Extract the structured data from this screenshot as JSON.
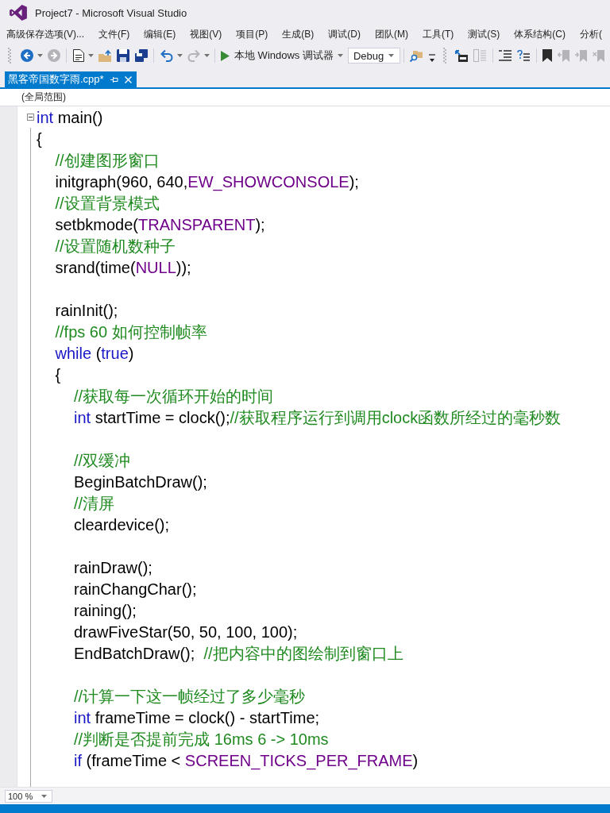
{
  "window": {
    "title": "Project7 - Microsoft Visual Studio"
  },
  "menu_bar": [
    "高级保存选项(V)...",
    "文件(F)",
    "编辑(E)",
    "视图(V)",
    "项目(P)",
    "生成(B)",
    "调试(D)",
    "团队(M)",
    "工具(T)",
    "测试(S)",
    "体系结构(C)",
    "分析("
  ],
  "toolbars": [
    {
      "groups": [
        [
          {
            "kind": "back",
            "disabled": false,
            "dropdown": true
          },
          {
            "kind": "forward",
            "disabled": true,
            "dropdown": false
          }
        ],
        [
          {
            "kind": "new_project",
            "disabled": false,
            "dropdown": true
          },
          {
            "kind": "open_file",
            "disabled": false,
            "dropdown": false
          },
          {
            "kind": "save",
            "disabled": false,
            "dropdown": false
          },
          {
            "kind": "save_all",
            "disabled": false,
            "dropdown": false
          }
        ],
        [
          {
            "kind": "undo",
            "disabled": false,
            "dropdown": true
          },
          {
            "kind": "redo",
            "disabled": true,
            "dropdown": true
          }
        ],
        [
          {
            "kind": "start_debugging",
            "label": "本地 Windows 调试器",
            "disabled": false,
            "dropdown": true
          },
          {
            "kind": "configuration",
            "value": "Debug",
            "disabled": false,
            "dropdown": true
          }
        ],
        [
          {
            "kind": "find_in_files",
            "disabled": false,
            "dropdown": false
          }
        ]
      ]
    },
    {
      "groups": [
        [
          {
            "kind": "box_arrow",
            "disabled": false,
            "dropdown": false
          },
          {
            "kind": "columns",
            "disabled": true,
            "dropdown": false
          }
        ],
        [
          {
            "kind": "lines",
            "disabled": false,
            "dropdown": false
          },
          {
            "kind": "question_lines",
            "disabled": false,
            "dropdown": false
          }
        ],
        [
          {
            "kind": "bookmark",
            "disabled": false,
            "dropdown": false
          },
          {
            "kind": "bookmark_previous",
            "disabled": true,
            "dropdown": false
          },
          {
            "kind": "bookmark_next",
            "disabled": true,
            "dropdown": false
          },
          {
            "kind": "bookmark_clear",
            "disabled": true,
            "dropdown": false
          }
        ]
      ]
    }
  ],
  "tabs": [
    {
      "label": "黑客帝国数字雨.cpp*",
      "selected": true
    }
  ],
  "navigation_bar": {
    "scope": "(全局范围)"
  },
  "editor": {
    "regions": [
      {
        "expanded": true,
        "lines": [
          {
            "kind": "code",
            "tokens": [
              {
                "kind": "keyword",
                "text": "int"
              },
              {
                "kind": "plain",
                "text": " main()"
              }
            ]
          },
          {
            "kind": "code",
            "tokens": [
              {
                "kind": "plain",
                "text": "{"
              }
            ],
            "children": [
              {
                "kind": "code",
                "tokens": [
                  {
                    "kind": "comment",
                    "text": "//创建图形窗口"
                  }
                ]
              },
              {
                "kind": "code",
                "tokens": [
                  {
                    "kind": "plain",
                    "text": "initgraph(960, 640,"
                  },
                  {
                    "kind": "macro",
                    "text": "EW_SHOWCONSOLE"
                  },
                  {
                    "kind": "plain",
                    "text": ");"
                  }
                ]
              },
              {
                "kind": "code",
                "tokens": [
                  {
                    "kind": "comment",
                    "text": "//设置背景模式"
                  }
                ]
              },
              {
                "kind": "code",
                "tokens": [
                  {
                    "kind": "plain",
                    "text": "setbkmode("
                  },
                  {
                    "kind": "macro",
                    "text": "TRANSPARENT"
                  },
                  {
                    "kind": "plain",
                    "text": ");"
                  }
                ]
              },
              {
                "kind": "code",
                "tokens": [
                  {
                    "kind": "comment",
                    "text": "//设置随机数种子"
                  }
                ]
              },
              {
                "kind": "code",
                "tokens": [
                  {
                    "kind": "plain",
                    "text": "srand(time("
                  },
                  {
                    "kind": "macro",
                    "text": "NULL"
                  },
                  {
                    "kind": "plain",
                    "text": "));"
                  }
                ]
              },
              {
                "kind": "blank"
              },
              {
                "kind": "code",
                "tokens": [
                  {
                    "kind": "plain",
                    "text": "rainInit();"
                  }
                ]
              },
              {
                "kind": "code",
                "tokens": [
                  {
                    "kind": "comment",
                    "text": "//fps 60 如何控制帧率"
                  }
                ]
              },
              {
                "kind": "code",
                "tokens": [
                  {
                    "kind": "keyword",
                    "text": "while"
                  },
                  {
                    "kind": "plain",
                    "text": " ("
                  },
                  {
                    "kind": "keyword",
                    "text": "true"
                  },
                  {
                    "kind": "plain",
                    "text": ")"
                  }
                ]
              },
              {
                "kind": "code",
                "tokens": [
                  {
                    "kind": "plain",
                    "text": "{"
                  }
                ],
                "children": [
                  {
                    "kind": "code",
                    "tokens": [
                      {
                        "kind": "comment",
                        "text": "//获取每一次循环开始的时间"
                      }
                    ]
                  },
                  {
                    "kind": "code",
                    "tokens": [
                      {
                        "kind": "keyword",
                        "text": "int"
                      },
                      {
                        "kind": "plain",
                        "text": " startTime = clock();"
                      },
                      {
                        "kind": "comment",
                        "text": "//获取程序运行到调用clock函数所经过的毫秒数"
                      }
                    ]
                  },
                  {
                    "kind": "blank"
                  },
                  {
                    "kind": "code",
                    "tokens": [
                      {
                        "kind": "comment",
                        "text": "//双缓冲"
                      }
                    ]
                  },
                  {
                    "kind": "code",
                    "tokens": [
                      {
                        "kind": "plain",
                        "text": "BeginBatchDraw();"
                      }
                    ]
                  },
                  {
                    "kind": "code",
                    "tokens": [
                      {
                        "kind": "comment",
                        "text": "//清屏"
                      }
                    ]
                  },
                  {
                    "kind": "code",
                    "tokens": [
                      {
                        "kind": "plain",
                        "text": "cleardevice();"
                      }
                    ]
                  },
                  {
                    "kind": "blank"
                  },
                  {
                    "kind": "code",
                    "tokens": [
                      {
                        "kind": "plain",
                        "text": "rainDraw();"
                      }
                    ]
                  },
                  {
                    "kind": "code",
                    "tokens": [
                      {
                        "kind": "plain",
                        "text": "rainChangChar();"
                      }
                    ]
                  },
                  {
                    "kind": "code",
                    "tokens": [
                      {
                        "kind": "plain",
                        "text": "raining();"
                      }
                    ]
                  },
                  {
                    "kind": "code",
                    "tokens": [
                      {
                        "kind": "plain",
                        "text": "drawFiveStar(50, 50, 100, 100);"
                      }
                    ]
                  },
                  {
                    "kind": "code",
                    "tokens": [
                      {
                        "kind": "plain",
                        "text": "EndBatchDraw();  "
                      },
                      {
                        "kind": "comment",
                        "text": "//把内容中的图绘制到窗口上"
                      }
                    ]
                  },
                  {
                    "kind": "blank"
                  },
                  {
                    "kind": "code",
                    "tokens": [
                      {
                        "kind": "comment",
                        "text": "//计算一下这一帧经过了多少毫秒"
                      }
                    ]
                  },
                  {
                    "kind": "code",
                    "tokens": [
                      {
                        "kind": "keyword",
                        "text": "int"
                      },
                      {
                        "kind": "plain",
                        "text": " frameTime = clock() - startTime;"
                      }
                    ]
                  },
                  {
                    "kind": "code",
                    "tokens": [
                      {
                        "kind": "comment",
                        "text": "//判断是否提前完成 16ms 6 -> 10ms"
                      }
                    ]
                  },
                  {
                    "kind": "code",
                    "tokens": [
                      {
                        "kind": "keyword",
                        "text": "if"
                      },
                      {
                        "kind": "plain",
                        "text": " (frameTime < "
                      },
                      {
                        "kind": "macro",
                        "text": "SCREEN_TICKS_PER_FRAME"
                      },
                      {
                        "kind": "plain",
                        "text": ")"
                      }
                    ]
                  }
                ]
              }
            ]
          }
        ]
      }
    ]
  },
  "zoom": "100 %"
}
